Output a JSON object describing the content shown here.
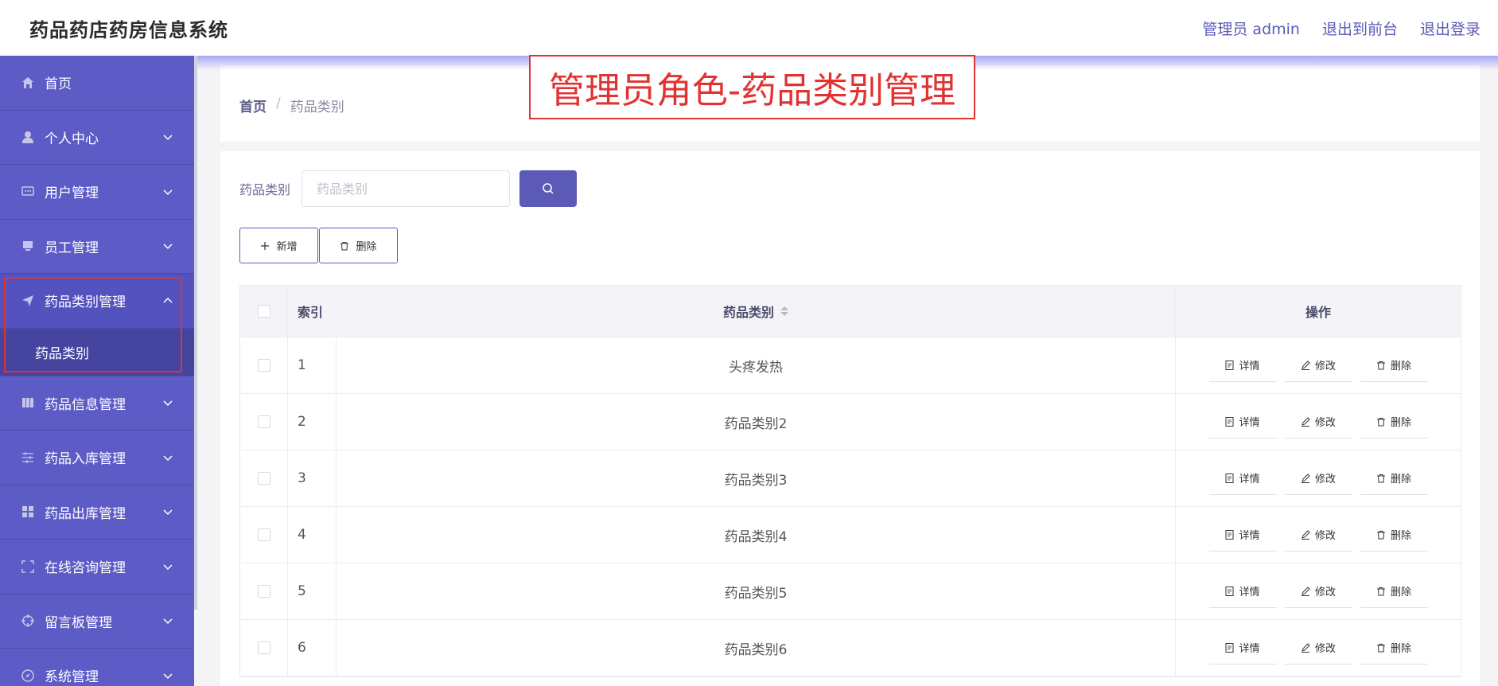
{
  "header": {
    "title": "药品药店药房信息系统",
    "links": [
      "管理员 admin",
      "退出到前台",
      "退出登录"
    ]
  },
  "sidebar": {
    "items": [
      {
        "label": "首页",
        "icon": "home-icon"
      },
      {
        "label": "个人中心",
        "icon": "user-icon"
      },
      {
        "label": "用户管理",
        "icon": "chat-icon"
      },
      {
        "label": "员工管理",
        "icon": "monitor-icon"
      },
      {
        "label": "药品类别管理",
        "icon": "send-icon"
      },
      {
        "label": "药品信息管理",
        "icon": "columns-icon"
      },
      {
        "label": "药品入库管理",
        "icon": "sliders-icon"
      },
      {
        "label": "药品出库管理",
        "icon": "grid-icon"
      },
      {
        "label": "在线咨询管理",
        "icon": "fullscreen-icon"
      },
      {
        "label": "留言板管理",
        "icon": "target-icon"
      },
      {
        "label": "系统管理",
        "icon": "compass-icon"
      }
    ],
    "submenu": {
      "label": "药品类别"
    }
  },
  "annotation": "管理员角色-药品类别管理",
  "breadcrumb": {
    "home": "首页",
    "separator": "/",
    "current": "药品类别"
  },
  "search": {
    "label": "药品类别",
    "placeholder": "药品类别"
  },
  "actions": {
    "add": "新增",
    "delete": "删除"
  },
  "table": {
    "headers": {
      "index": "索引",
      "category": "药品类别",
      "ops": "操作"
    },
    "op_labels": {
      "detail": "详情",
      "edit": "修改",
      "delete": "删除"
    },
    "rows": [
      {
        "index": "1",
        "category": "头疼发热"
      },
      {
        "index": "2",
        "category": "药品类别2"
      },
      {
        "index": "3",
        "category": "药品类别3"
      },
      {
        "index": "4",
        "category": "药品类别4"
      },
      {
        "index": "5",
        "category": "药品类别5"
      },
      {
        "index": "6",
        "category": "药品类别6"
      }
    ]
  },
  "colors": {
    "primary": "#5b5bb7",
    "sidebar": "#5d5cc6",
    "annotation": "#e23333"
  }
}
